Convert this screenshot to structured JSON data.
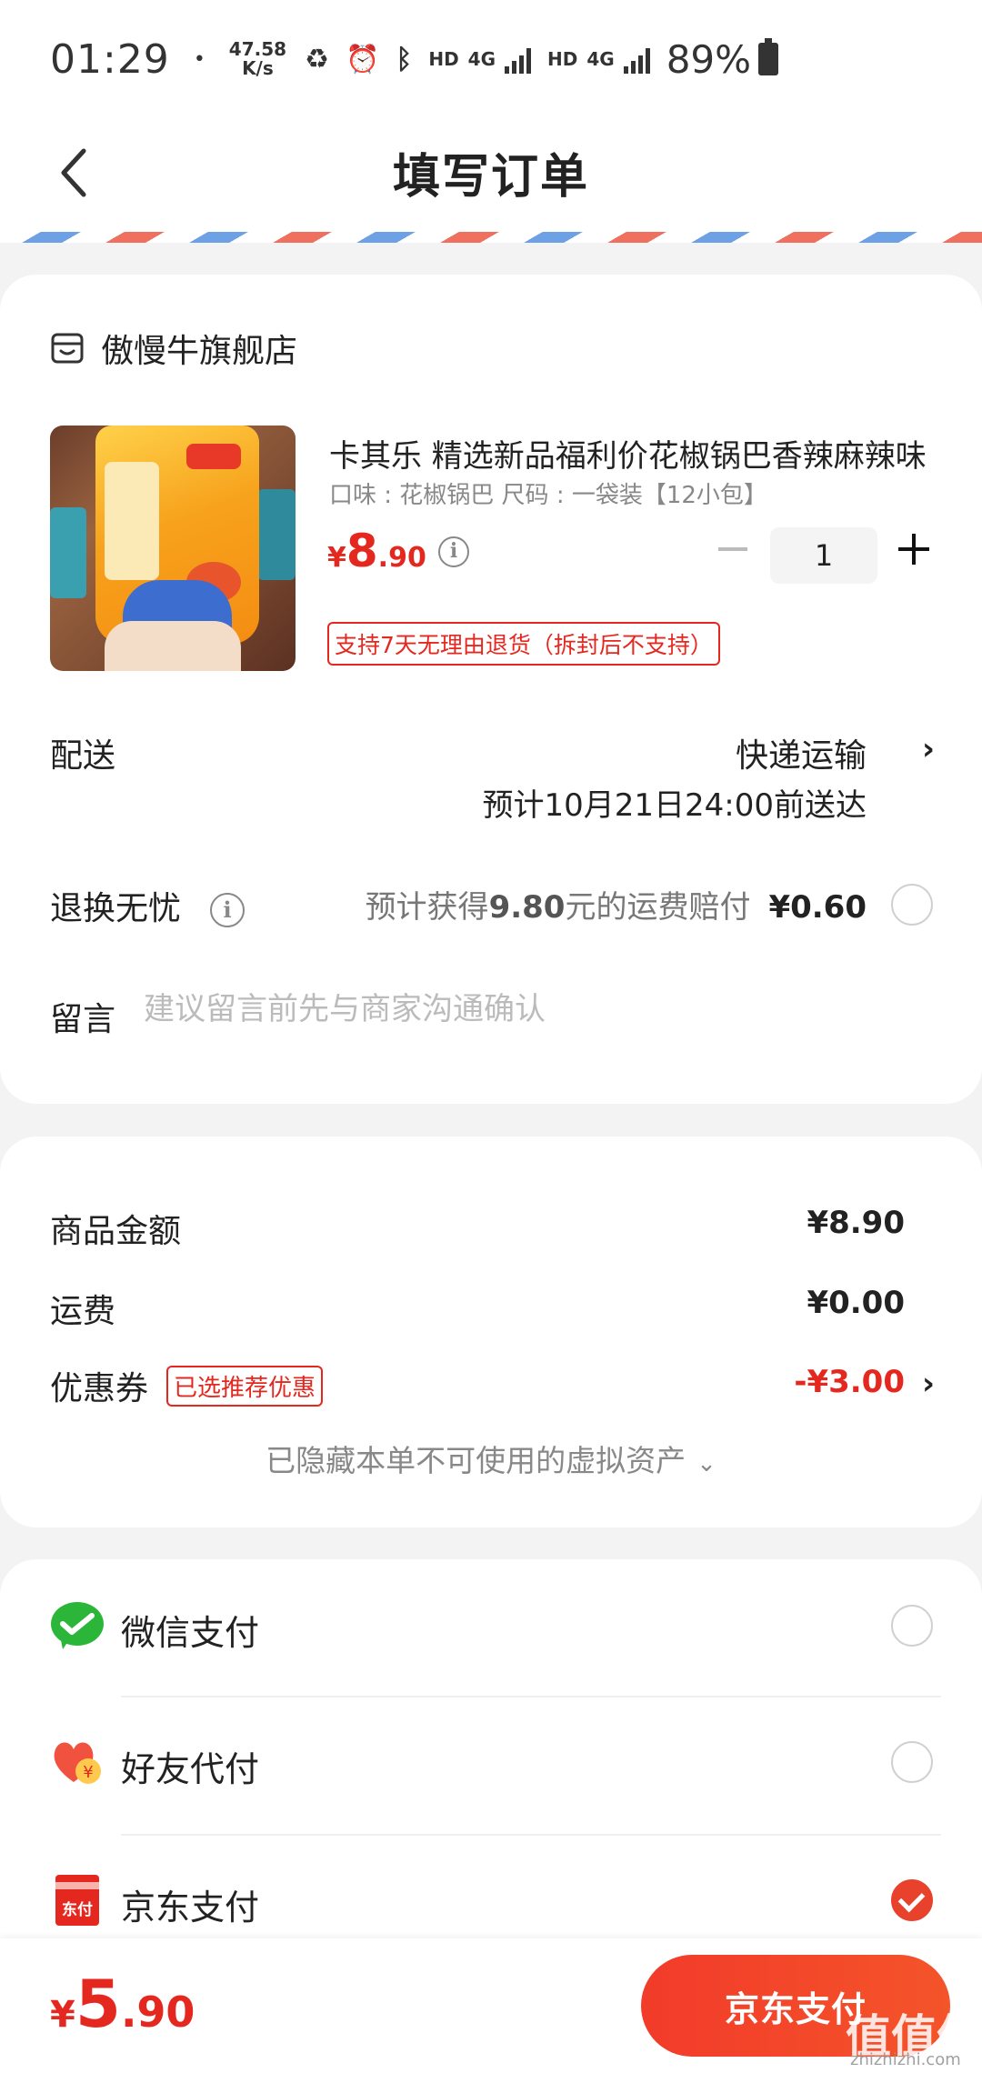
{
  "status_bar": {
    "time": "01:29",
    "dot": "•",
    "speed_value": "47.58",
    "speed_unit": "K/s",
    "hd1": "HD",
    "net1": "4G",
    "hd2": "HD",
    "net2": "4G",
    "battery": "89%"
  },
  "header": {
    "title": "填写订单",
    "back_icon": "chevron-left-icon"
  },
  "shop": {
    "name": "傲慢牛旗舰店",
    "icon": "shop-icon"
  },
  "product": {
    "title": "卡其乐 精选新品福利价花椒锅巴香辣麻辣味",
    "spec": "口味 : 花椒锅巴   尺码 : 一袋装【12小包】",
    "price_symbol": "¥",
    "price_int": "8",
    "price_dec": ".90",
    "quantity": "1",
    "return_policy": "支持7天无理由退货（拆封后不支持）"
  },
  "delivery": {
    "label": "配送",
    "method": "快递运输",
    "eta": "预计10月21日24:00前送达"
  },
  "return_worry": {
    "label": "退换无忧",
    "text_pre": "预计获得",
    "text_amount": "9.80",
    "text_post": "元的运费赔付",
    "price": "¥0.60"
  },
  "memo": {
    "label": "留言",
    "placeholder": "建议留言前先与商家沟通确认"
  },
  "summary": {
    "goods_label": "商品金额",
    "goods_value": "¥8.90",
    "shipping_label": "运费",
    "shipping_value": "¥0.00",
    "coupon_label": "优惠券",
    "coupon_tag": "已选推荐优惠",
    "coupon_value": "-¥3.00",
    "hidden_assets": "已隐藏本单不可使用的虚拟资产"
  },
  "payment_methods": [
    {
      "label": "微信支付",
      "icon": "wechat-pay-icon",
      "selected": false
    },
    {
      "label": "好友代付",
      "icon": "friend-pay-icon",
      "selected": false
    },
    {
      "label": "京东支付",
      "icon": "jd-pay-icon",
      "selected": true
    }
  ],
  "jd_icon_text": "东付",
  "friend_icon_text": "¥",
  "bottom": {
    "total_symbol": "¥",
    "total_int": "5",
    "total_dec": ".90",
    "pay_button": "京东支付"
  },
  "watermark": {
    "main": "值值值",
    "sub": "zhizhizhi.com"
  },
  "colors": {
    "accent": "#e5281f",
    "pay_button": "#f23b2a",
    "checked": "#e8412c"
  }
}
